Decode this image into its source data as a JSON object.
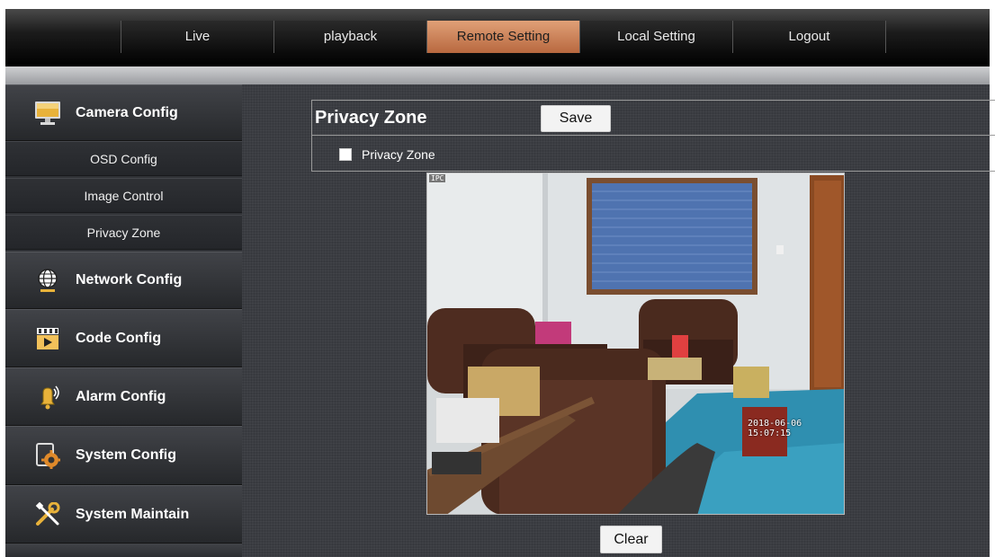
{
  "nav": {
    "tabs": [
      {
        "label": "Live"
      },
      {
        "label": "playback"
      },
      {
        "label": "Remote Setting",
        "active": true
      },
      {
        "label": "Local Setting"
      },
      {
        "label": "Logout"
      }
    ],
    "active_color": "#c97a4f"
  },
  "sidebar": {
    "camera_config": {
      "label": "Camera Config",
      "icon": "monitor-icon"
    },
    "sub_items": [
      {
        "label": "OSD Config"
      },
      {
        "label": "Image Control"
      },
      {
        "label": "Privacy Zone"
      }
    ],
    "network_config": {
      "label": "Network Config",
      "icon": "globe-icon"
    },
    "code_config": {
      "label": "Code Config",
      "icon": "video-play-icon"
    },
    "alarm_config": {
      "label": "Alarm Config",
      "icon": "alarm-bell-icon"
    },
    "system_config": {
      "label": "System Config",
      "icon": "settings-gear-icon"
    },
    "system_maintain": {
      "label": "System Maintain",
      "icon": "wrench-screwdriver-icon"
    }
  },
  "panel": {
    "title": "Privacy Zone",
    "save_label": "Save",
    "checkbox_label": "Privacy Zone",
    "checkbox_checked": false,
    "clear_label": "Clear"
  },
  "video": {
    "camera_label": "IPC",
    "timestamp": "2018-06-06 15:07:15"
  }
}
